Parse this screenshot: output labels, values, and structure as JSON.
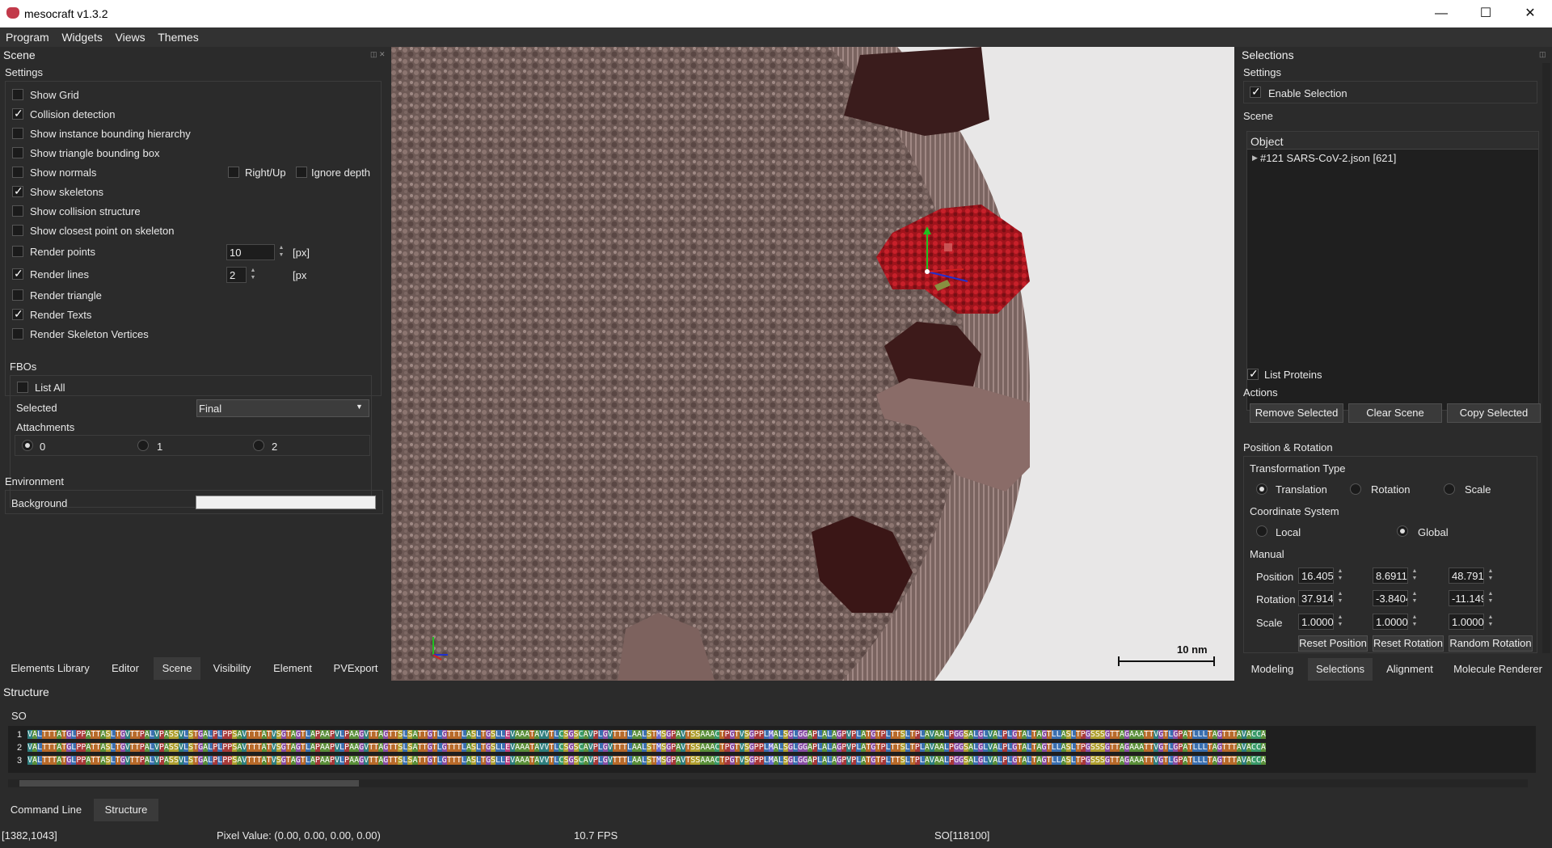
{
  "window": {
    "title": "mesocraft v1.3.2",
    "controls": [
      "—",
      "☐",
      "✕"
    ]
  },
  "menu": [
    "Program",
    "Widgets",
    "Views",
    "Themes"
  ],
  "scene_panel": {
    "title": "Scene",
    "settings_label": "Settings",
    "options": [
      {
        "label": "Show Grid",
        "checked": false
      },
      {
        "label": "Collision detection",
        "checked": true
      },
      {
        "label": "Show instance bounding hierarchy",
        "checked": false
      },
      {
        "label": "Show triangle bounding box",
        "checked": false
      },
      {
        "label": "Show normals",
        "checked": false
      },
      {
        "label": "Show skeletons",
        "checked": true
      },
      {
        "label": "Show collision structure",
        "checked": false
      },
      {
        "label": "Show closest point on skeleton",
        "checked": false
      },
      {
        "label": "Render points",
        "checked": false
      },
      {
        "label": "Render lines",
        "checked": true
      },
      {
        "label": "Render triangle",
        "checked": false
      },
      {
        "label": "Render Texts",
        "checked": true
      },
      {
        "label": "Render Skeleton Vertices",
        "checked": false
      }
    ],
    "right_up_label": "Right/Up",
    "ignore_depth_label": "Ignore depth",
    "render_points_value": "10",
    "render_lines_value": "2",
    "px_unit": "[px]",
    "px_unit_cut": "[px",
    "fbos": {
      "title": "FBOs",
      "list_all": "List All",
      "selected_label": "Selected",
      "selected_value": "Final",
      "attachments_label": "Attachments",
      "attachments": [
        "0",
        "1",
        "2"
      ]
    },
    "environment": {
      "title": "Environment",
      "background_label": "Background",
      "background_color": "#f0f0f0"
    }
  },
  "left_tabs": [
    "Elements Library",
    "Editor",
    "Scene",
    "Visibility",
    "Element",
    "PVExport"
  ],
  "viewport": {
    "scale_bar_label": "10 nm"
  },
  "selections_panel": {
    "title": "Selections",
    "settings_label": "Settings",
    "enable_selection": "Enable Selection",
    "scene_label": "Scene",
    "object_header": "Object",
    "object_item": "#121 SARS-CoV-2.json [621]",
    "list_proteins": "List Proteins",
    "actions_label": "Actions",
    "buttons": [
      "Remove Selected",
      "Clear Scene",
      "Copy Selected"
    ],
    "pos_rot_label": "Position & Rotation",
    "transformation_type_label": "Transformation Type",
    "transformation_types": [
      "Translation",
      "Rotation",
      "Scale"
    ],
    "coordinate_system_label": "Coordinate System",
    "coordinate_systems": [
      "Local",
      "Global"
    ],
    "manual_label": "Manual",
    "position_label": "Position",
    "rotation_label": "Rotation",
    "scale_label": "Scale",
    "position": [
      "16.405",
      "8.6911",
      "48.791"
    ],
    "rotation": [
      "37.914",
      "-3.8404",
      "-11.149"
    ],
    "scale": [
      "1.0000",
      "1.0000",
      "1.0000"
    ],
    "reset_buttons": [
      "Reset Position",
      "Reset Rotation",
      "Random Rotation"
    ]
  },
  "right_tabs": [
    "Modeling",
    "Selections",
    "Alignment",
    "Molecule Renderer"
  ],
  "structure_panel": {
    "title": "Structure",
    "chain": "SO",
    "row_numbers": [
      "1",
      "2",
      "3"
    ],
    "sequence": "VALTTTATGLPPATTASLTGVTTPALVPASSVLSTGALPLPPSAVTTTATVSGTAGTLAPAAPVLPAAGVTTAGTTSLSATTGTLGTTTLASLTGSLLEVAAATAVVTLCSGSCAVPLGVTTTLAALSTMSGPAVTSSAAACTPGTVSGPPLMALSGLGGAPLALAGPVPLATGTPLTTSLTPLAVAALPGGSALGLVALPLGTALTAGTLLASLTPGSSSGTTAGAAATTVGTLGPATLLLTAGTTTAVACCA"
  },
  "bottom_tabs": [
    "Command Line",
    "Structure"
  ],
  "statusbar": {
    "coords": "[1382,1043]",
    "pixel_value": "Pixel Value: (0.00, 0.00, 0.00, 0.00)",
    "fps": "10.7 FPS",
    "selection": "SO[118100]"
  },
  "colors": {
    "A": "#5a8f3a",
    "V": "#2f7f7f",
    "L": "#3a6fb0",
    "T": "#b86a2a",
    "G": "#8a4fa6",
    "S": "#b0a030",
    "P": "#a83a3a",
    "C": "#3a9a6a",
    "M": "#6a6ad0",
    "E": "#c04080"
  }
}
